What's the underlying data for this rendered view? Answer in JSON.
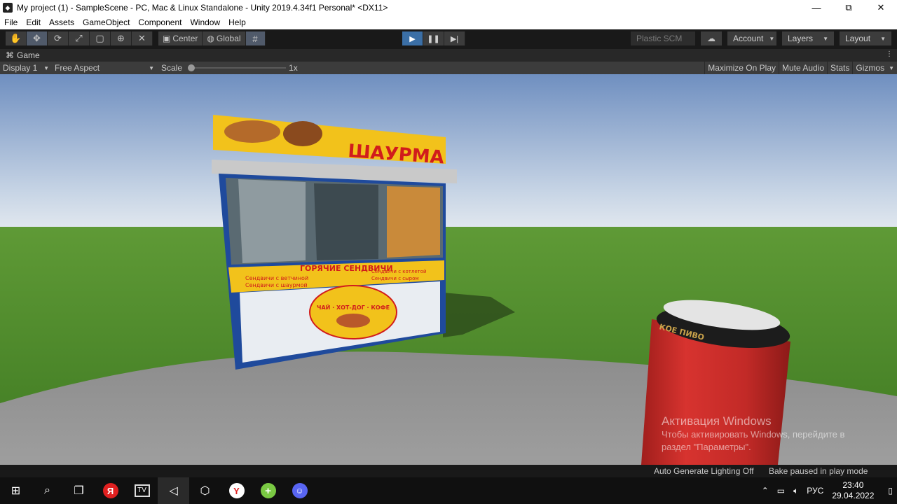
{
  "window": {
    "title": "My project (1) - SampleScene - PC, Mac & Linux Standalone - Unity 2019.4.34f1 Personal* <DX11>",
    "minimize": "—",
    "restore": "⧉",
    "close": "✕"
  },
  "menu": [
    "File",
    "Edit",
    "Assets",
    "GameObject",
    "Component",
    "Window",
    "Help"
  ],
  "toolbar": {
    "pivot_label": "Center",
    "space_label": "Global",
    "plastic_label": "Plastic SCM",
    "account_label": "Account",
    "layers_label": "Layers",
    "layout_label": "Layout"
  },
  "game_tab": {
    "label": "Game"
  },
  "game_toolbar": {
    "display": "Display 1",
    "aspect": "Free Aspect",
    "scale_label": "Scale",
    "scale_value": "1x",
    "maximize": "Maximize On Play",
    "mute": "Mute Audio",
    "stats": "Stats",
    "gizmos": "Gizmos"
  },
  "scene": {
    "kiosk_sign": "ШАУРМА",
    "banner_title": "ГОРЯЧИЕ СЕНДВИЧИ",
    "banner_left_1": "Сендвичи с ветчиной",
    "banner_left_2": "Сендвичи с шаурмой",
    "banner_right_1": "Сендвичи с котлетой",
    "banner_right_2": "Сендвичи с сыром",
    "oval_text": "ЧАЙ · ХОТ-ДОГ · КОФЕ",
    "can_text": "КОЕ ПИВО"
  },
  "watermark": {
    "title": "Активация Windows",
    "line1": "Чтобы активировать Windows, перейдите в",
    "line2": "раздел \"Параметры\"."
  },
  "status": {
    "lighting": "Auto Generate Lighting Off",
    "bake": "Bake paused in play mode"
  },
  "taskbar": {
    "lang": "РУС",
    "time": "23:40",
    "date": "29.04.2022"
  },
  "colors": {
    "play_active": "#3b6fa6",
    "sky_top": "#6f8fc0",
    "sky_bottom": "#dde6f0",
    "grass": "#4f8a2e",
    "kiosk_yellow": "#f2c21b",
    "kiosk_blue": "#1f4a9c",
    "can_red": "#c22a27"
  }
}
